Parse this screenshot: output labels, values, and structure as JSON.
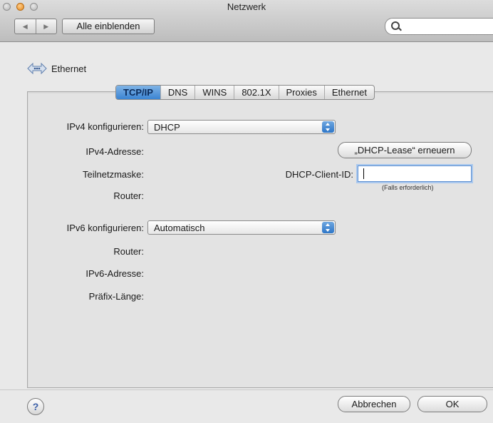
{
  "window": {
    "title": "Netzwerk"
  },
  "toolbar": {
    "back_glyph": "◀",
    "forward_glyph": "▶",
    "show_all_label": "Alle einblenden",
    "search_icon": "magnifier-icon"
  },
  "header": {
    "title": "Ethernet",
    "icon": "ethernet-icon"
  },
  "tabs": [
    {
      "label": "TCP/IP",
      "active": true
    },
    {
      "label": "DNS",
      "active": false
    },
    {
      "label": "WINS",
      "active": false
    },
    {
      "label": "802.1X",
      "active": false
    },
    {
      "label": "Proxies",
      "active": false
    },
    {
      "label": "Ethernet",
      "active": false
    }
  ],
  "ipv4": {
    "configure_label": "IPv4 konfigurieren:",
    "configure_value": "DHCP",
    "address_label": "IPv4-Adresse:",
    "subnet_label": "Teilnetzmaske:",
    "router_label": "Router:",
    "renew_button": "„DHCP-Lease“ erneuern",
    "client_id_label": "DHCP-Client-ID:",
    "client_id_value": "",
    "client_id_hint": "(Falls erforderlich)"
  },
  "ipv6": {
    "configure_label": "IPv6 konfigurieren:",
    "configure_value": "Automatisch",
    "router_label": "Router:",
    "address_label": "IPv6-Adresse:",
    "prefix_label": "Präfix-Länge:"
  },
  "footer": {
    "help_label": "?",
    "cancel_button": "Abbrechen",
    "ok_button": "OK"
  }
}
